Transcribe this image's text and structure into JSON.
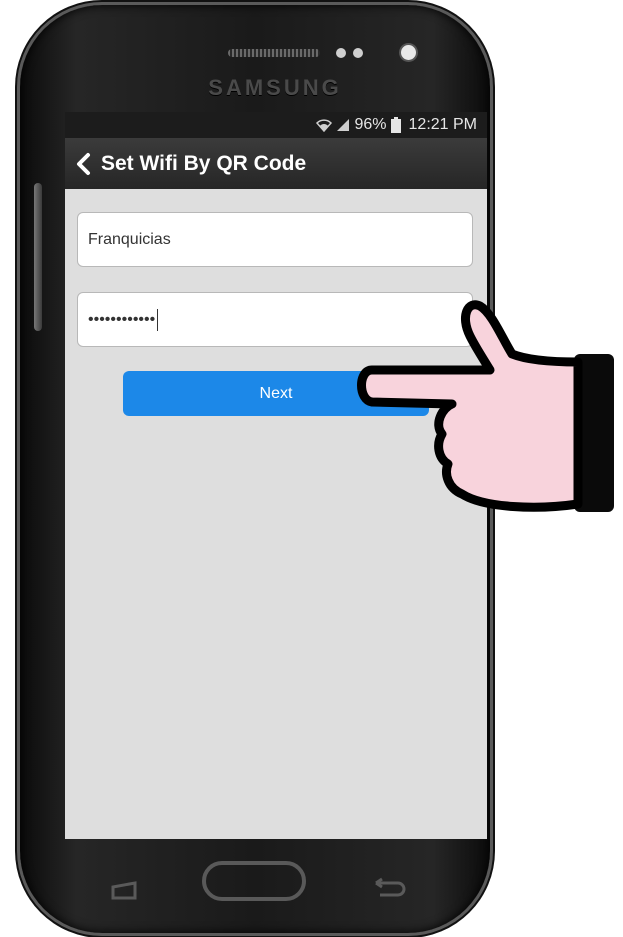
{
  "device": {
    "brand": "SAMSUNG"
  },
  "status_bar": {
    "battery": "96%",
    "time": "12:21 PM",
    "icons": [
      "wifi-icon",
      "signal-icon",
      "battery-icon"
    ]
  },
  "app_bar": {
    "title": "Set Wifi By QR Code",
    "back_icon": "chevron-left-icon"
  },
  "form": {
    "ssid_value": "Franquicias",
    "password_value": "••••••••••••",
    "next_label": "Next"
  },
  "colors": {
    "accent": "#1c88e8",
    "screen_bg": "#dedede",
    "app_bar": "#2e2e2e",
    "hand_fill": "#f8d3dc"
  },
  "annotation": {
    "icon": "pointing-hand-icon"
  }
}
